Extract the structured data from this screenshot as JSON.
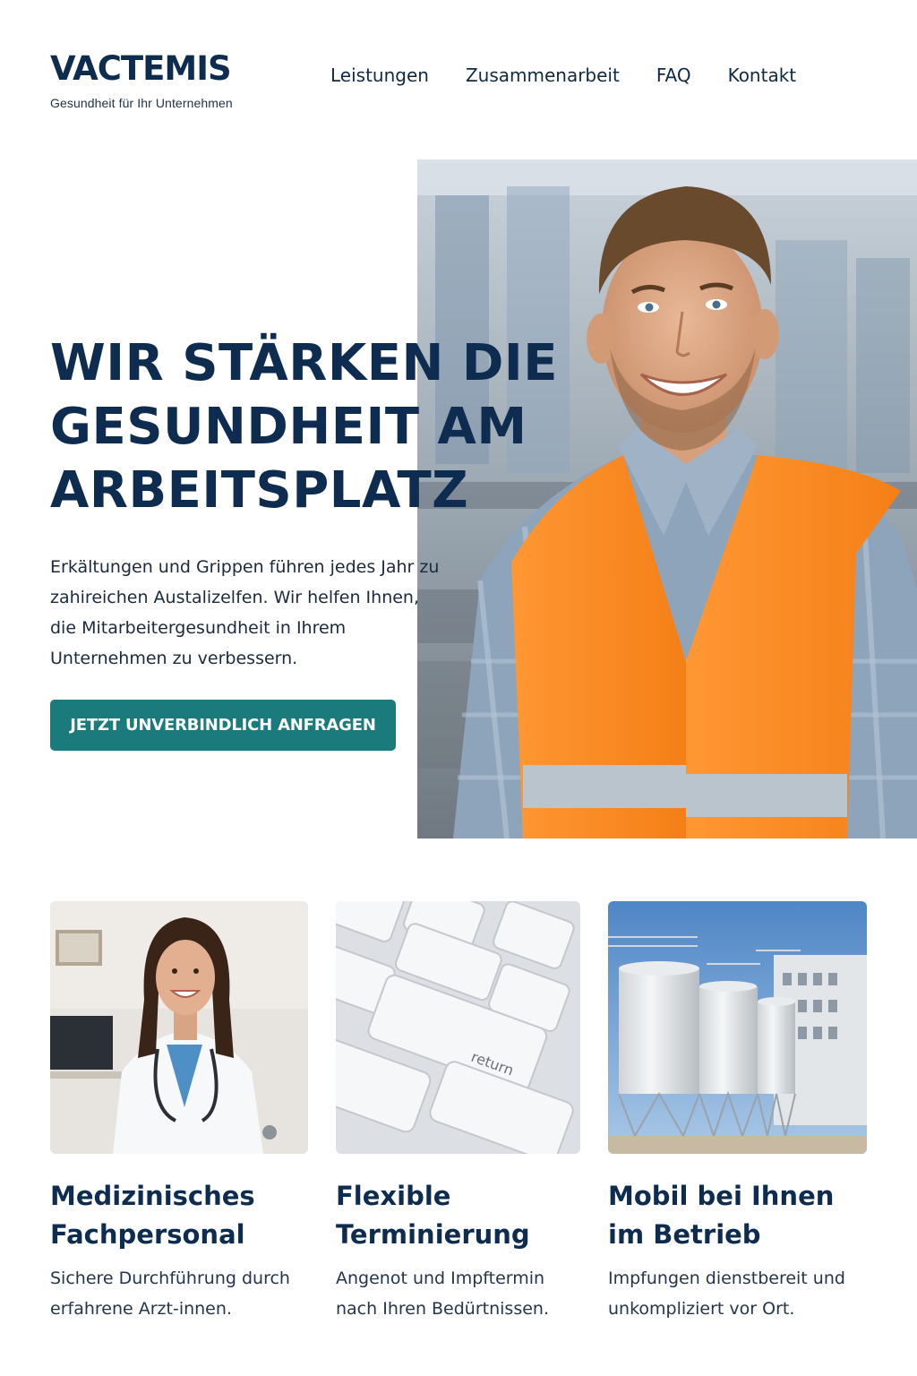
{
  "header": {
    "logo_text": "VACTEMIS",
    "tagline": "Gesundheit für Ihr Unternehmen",
    "nav": [
      {
        "label": "Leistungen"
      },
      {
        "label": "Zusammenarbeit"
      },
      {
        "label": "FAQ"
      },
      {
        "label": "Kontakt"
      }
    ]
  },
  "hero": {
    "title_lines": [
      "WIR STÄRKEN DIE",
      "GESUNDHEIT AM",
      "ARBEITSPLATZ"
    ],
    "text_lines": [
      "Erkältungen und Grippen führen jedes Jahr zu",
      "zahireichen Austalizelfen. Wir helfen Ihnen,",
      "die Mitarbeitergesundheit in Ihrem",
      "Unternehmen zu verbessern."
    ],
    "cta_label": "JETZT UNVERBINDLICH ANFRAGEN",
    "image_subject": "smiling worker in orange safety vest in factory hall"
  },
  "features": [
    {
      "title_lines": [
        "Medizinisches",
        "Fachpersonal"
      ],
      "text_lines": [
        "Sichere Durchführung durch",
        "erfahrene Arzt-innen."
      ],
      "image_subject": "smiling female doctor with stethoscope"
    },
    {
      "title_lines": [
        "Flexible",
        "Terminierung"
      ],
      "text_lines": [
        "Angenot und Impftermin",
        "nach Ihren Bedürtnissen."
      ],
      "image_subject": "close-up of white keyboard",
      "key_label": "return"
    },
    {
      "title_lines": [
        "Mobil bei Ihnen",
        "im Betrieb"
      ],
      "text_lines": [
        "Impfungen dienstbereit und",
        "unkompliziert vor Ort."
      ],
      "image_subject": "industrial silos in front of a factory building"
    }
  ],
  "colors": {
    "brand_navy": "#0d2c4f",
    "cta_teal": "#1a7a7c",
    "vest_orange": "#ff8a22",
    "shirt_blue": "#8ea4bb"
  }
}
